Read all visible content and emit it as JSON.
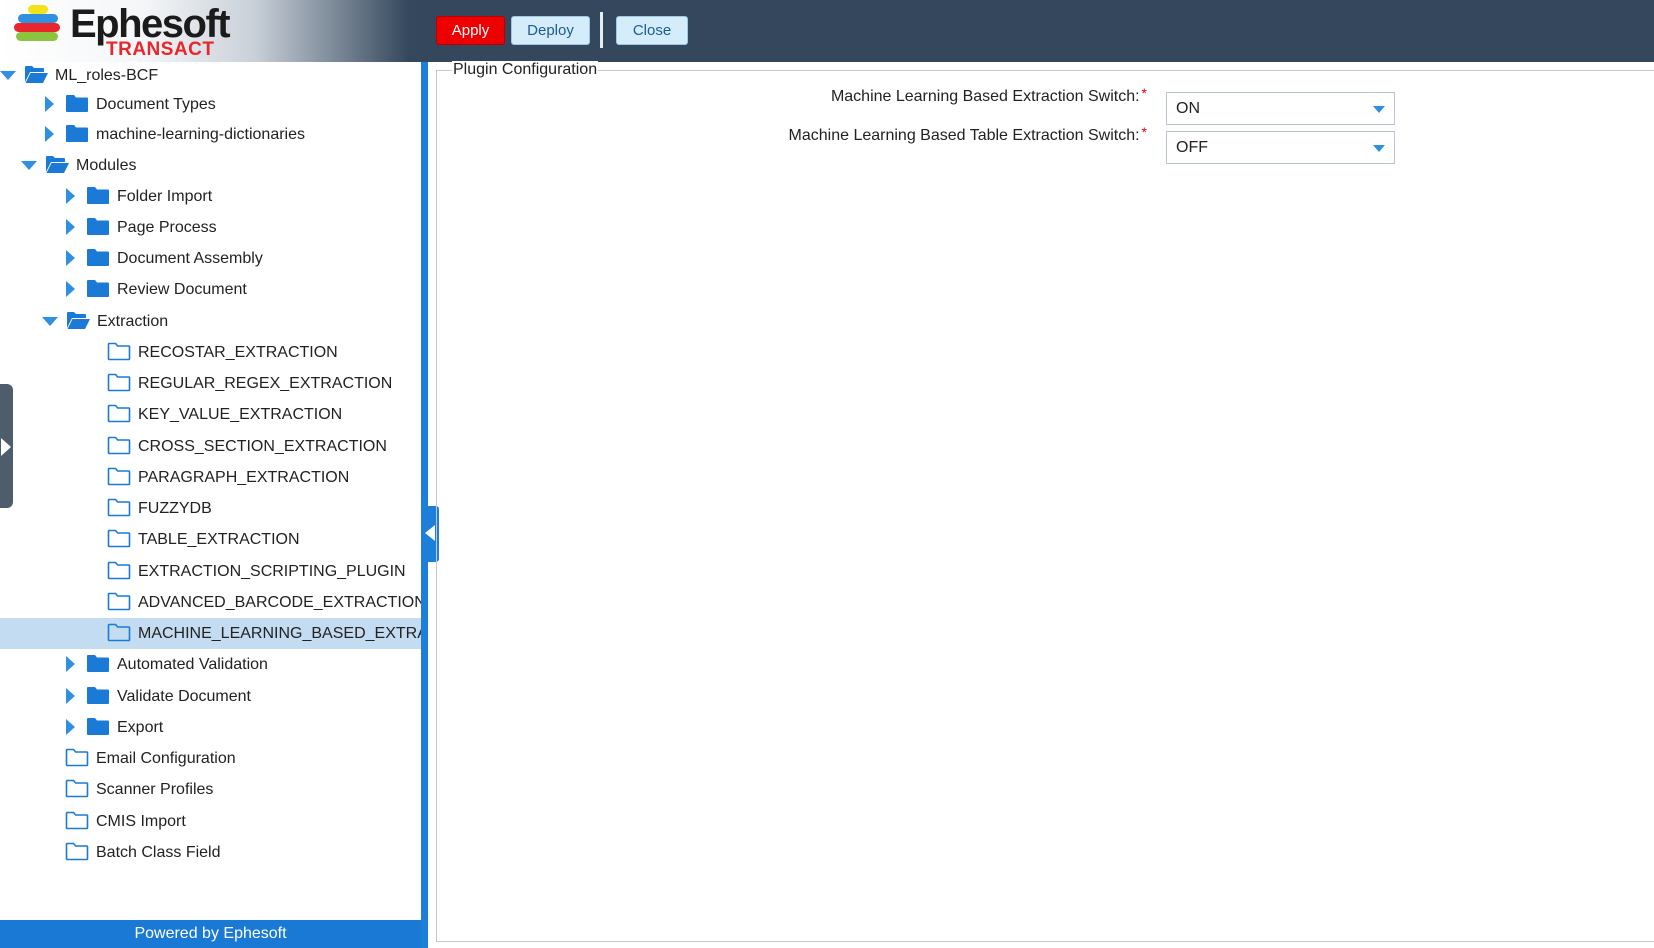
{
  "header": {
    "logo_word": "Ephesoft",
    "logo_sub": "TRANSACT",
    "apply_label": "Apply",
    "deploy_label": "Deploy",
    "close_label": "Close"
  },
  "tree": {
    "items": [
      {
        "label": "ML_roles-BCF",
        "icon": "folder-open-icon",
        "state": "expanded"
      },
      {
        "label": "Document Types",
        "icon": "folder-icon",
        "state": "collapsed"
      },
      {
        "label": "machine-learning-dictionaries",
        "icon": "folder-icon",
        "state": "collapsed"
      },
      {
        "label": "Modules",
        "icon": "folder-open-icon",
        "state": "expanded"
      },
      {
        "label": "Folder Import",
        "icon": "folder-icon",
        "state": "collapsed"
      },
      {
        "label": "Page Process",
        "icon": "folder-icon",
        "state": "collapsed"
      },
      {
        "label": "Document Assembly",
        "icon": "folder-icon",
        "state": "collapsed"
      },
      {
        "label": "Review Document",
        "icon": "folder-icon",
        "state": "collapsed"
      },
      {
        "label": "Extraction",
        "icon": "folder-open-icon",
        "state": "expanded"
      },
      {
        "label": "RECOSTAR_EXTRACTION",
        "icon": "folder-outline-icon",
        "state": "leaf"
      },
      {
        "label": "REGULAR_REGEX_EXTRACTION",
        "icon": "folder-outline-icon",
        "state": "leaf"
      },
      {
        "label": "KEY_VALUE_EXTRACTION",
        "icon": "folder-outline-icon",
        "state": "leaf"
      },
      {
        "label": "CROSS_SECTION_EXTRACTION",
        "icon": "folder-outline-icon",
        "state": "leaf"
      },
      {
        "label": "PARAGRAPH_EXTRACTION",
        "icon": "folder-outline-icon",
        "state": "leaf"
      },
      {
        "label": "FUZZYDB",
        "icon": "folder-outline-icon",
        "state": "leaf"
      },
      {
        "label": "TABLE_EXTRACTION",
        "icon": "folder-outline-icon",
        "state": "leaf"
      },
      {
        "label": "EXTRACTION_SCRIPTING_PLUGIN",
        "icon": "folder-outline-icon",
        "state": "leaf"
      },
      {
        "label": "ADVANCED_BARCODE_EXTRACTION",
        "icon": "folder-outline-icon",
        "state": "leaf"
      },
      {
        "label": "MACHINE_LEARNING_BASED_EXTRAC",
        "icon": "folder-outline-icon",
        "state": "leaf",
        "selected": true
      },
      {
        "label": "Automated Validation",
        "icon": "folder-icon",
        "state": "collapsed"
      },
      {
        "label": "Validate Document",
        "icon": "folder-icon",
        "state": "collapsed"
      },
      {
        "label": "Export",
        "icon": "folder-icon",
        "state": "collapsed"
      },
      {
        "label": "Email Configuration",
        "icon": "folder-outline-icon",
        "state": "leaf"
      },
      {
        "label": "Scanner Profiles",
        "icon": "folder-outline-icon",
        "state": "leaf"
      },
      {
        "label": "CMIS Import",
        "icon": "folder-outline-icon",
        "state": "leaf"
      },
      {
        "label": "Batch Class Field",
        "icon": "folder-outline-icon",
        "state": "leaf"
      }
    ]
  },
  "footer": {
    "text": "Powered by Ephesoft"
  },
  "config": {
    "legend": "Plugin Configuration",
    "fields": [
      {
        "label": "Machine Learning Based Extraction Switch:",
        "required_mark": "*",
        "value": "ON"
      },
      {
        "label": "Machine Learning Based Table Extraction Switch:",
        "required_mark": "*",
        "value": "OFF"
      }
    ]
  },
  "colors": {
    "header_bg": "#34475c",
    "accent_blue": "#1d7fd8",
    "apply_red": "#ee0000",
    "selected_row": "#c4dcf2"
  }
}
